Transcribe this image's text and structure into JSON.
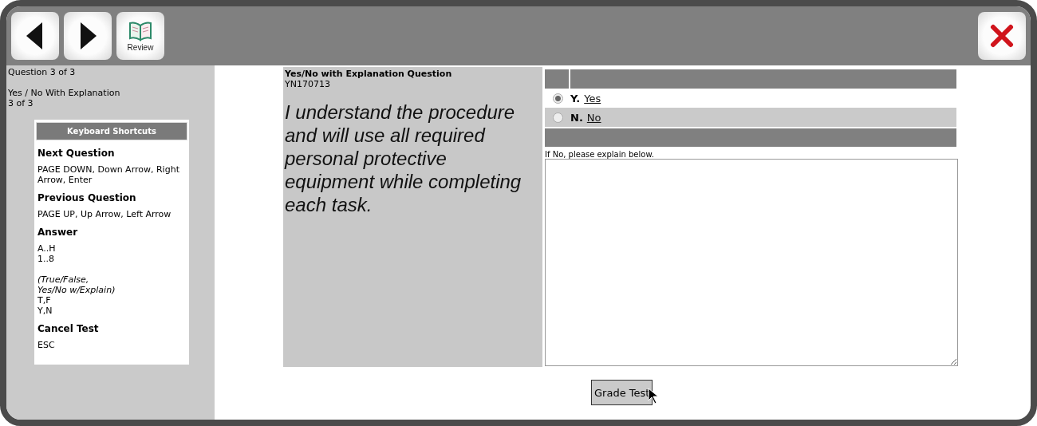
{
  "toolbar": {
    "buttons": [
      {
        "kind": "back"
      },
      {
        "kind": "forward"
      },
      {
        "kind": "review",
        "label": "Review"
      }
    ],
    "close": {
      "kind": "close"
    }
  },
  "sidebar": {
    "progress": "Question 3 of 3",
    "type": "Yes / No With Explanation",
    "count": "3 of 3",
    "shortcuts": {
      "title": "Keyboard Shortcuts",
      "sections": [
        {
          "heading": "Next Question",
          "lines": [
            {
              "kind": "text",
              "text": "PAGE DOWN, Down Arrow, Right Arrow, Enter"
            }
          ]
        },
        {
          "heading": "Previous Question",
          "lines": [
            {
              "kind": "text",
              "text": "PAGE UP, Up Arrow, Left Arrow"
            }
          ]
        },
        {
          "heading": "Answer",
          "lines": [
            {
              "kind": "text",
              "text": "A..H"
            },
            {
              "kind": "text",
              "text": "1..8"
            },
            {
              "kind": "note",
              "text": "(True/False,\nYes/No w/Explain)"
            },
            {
              "kind": "text",
              "text": "T,F"
            },
            {
              "kind": "text",
              "text": "Y,N"
            }
          ]
        },
        {
          "heading": "Cancel Test",
          "lines": [
            {
              "kind": "text",
              "text": "ESC"
            }
          ]
        }
      ]
    }
  },
  "question": {
    "type_title": "Yes/No with Explanation Question",
    "code": "YN170713",
    "text": "I understand the procedure and will use all required personal protective equipment while completing each task.",
    "options": [
      {
        "letter": "Y.",
        "label": "Yes",
        "selected": true
      },
      {
        "letter": "N.",
        "label": "No",
        "selected": false
      }
    ],
    "explain_label": "If No, please explain below."
  },
  "grade_button": "Grade Test"
}
